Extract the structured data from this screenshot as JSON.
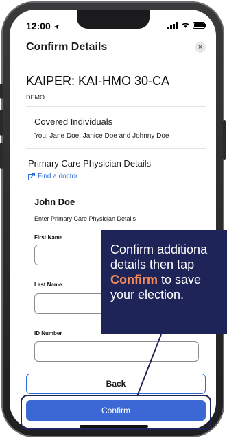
{
  "status_bar": {
    "time": "12:00"
  },
  "header": {
    "title": "Confirm Details",
    "close_symbol": "×"
  },
  "plan": {
    "name": "KAIPER: KAI-HMO 30-CA",
    "subtitle": "DEMO"
  },
  "covered": {
    "title": "Covered Individuals",
    "names": "You, Jane Doe, Janice Doe and Johnny Doe"
  },
  "pcp": {
    "title": "Primary Care Physician Details",
    "find_doctor": "Find a doctor",
    "person": "John Doe",
    "instructions": "Enter Primary Care Physician Details",
    "first_name_label": "First Name",
    "last_name_label": "Last Name",
    "id_label": "ID Number"
  },
  "buttons": {
    "back": "Back",
    "confirm": "Confirm"
  },
  "callout": {
    "line1": "Confirm additiona",
    "line2": "details then tap",
    "highlight": "Confirm",
    "line3_rest": " to save",
    "line4": "your election."
  },
  "colors": {
    "accent": "#3b68d4",
    "callout_bg": "#1f2458",
    "highlight": "#f28c5b"
  }
}
